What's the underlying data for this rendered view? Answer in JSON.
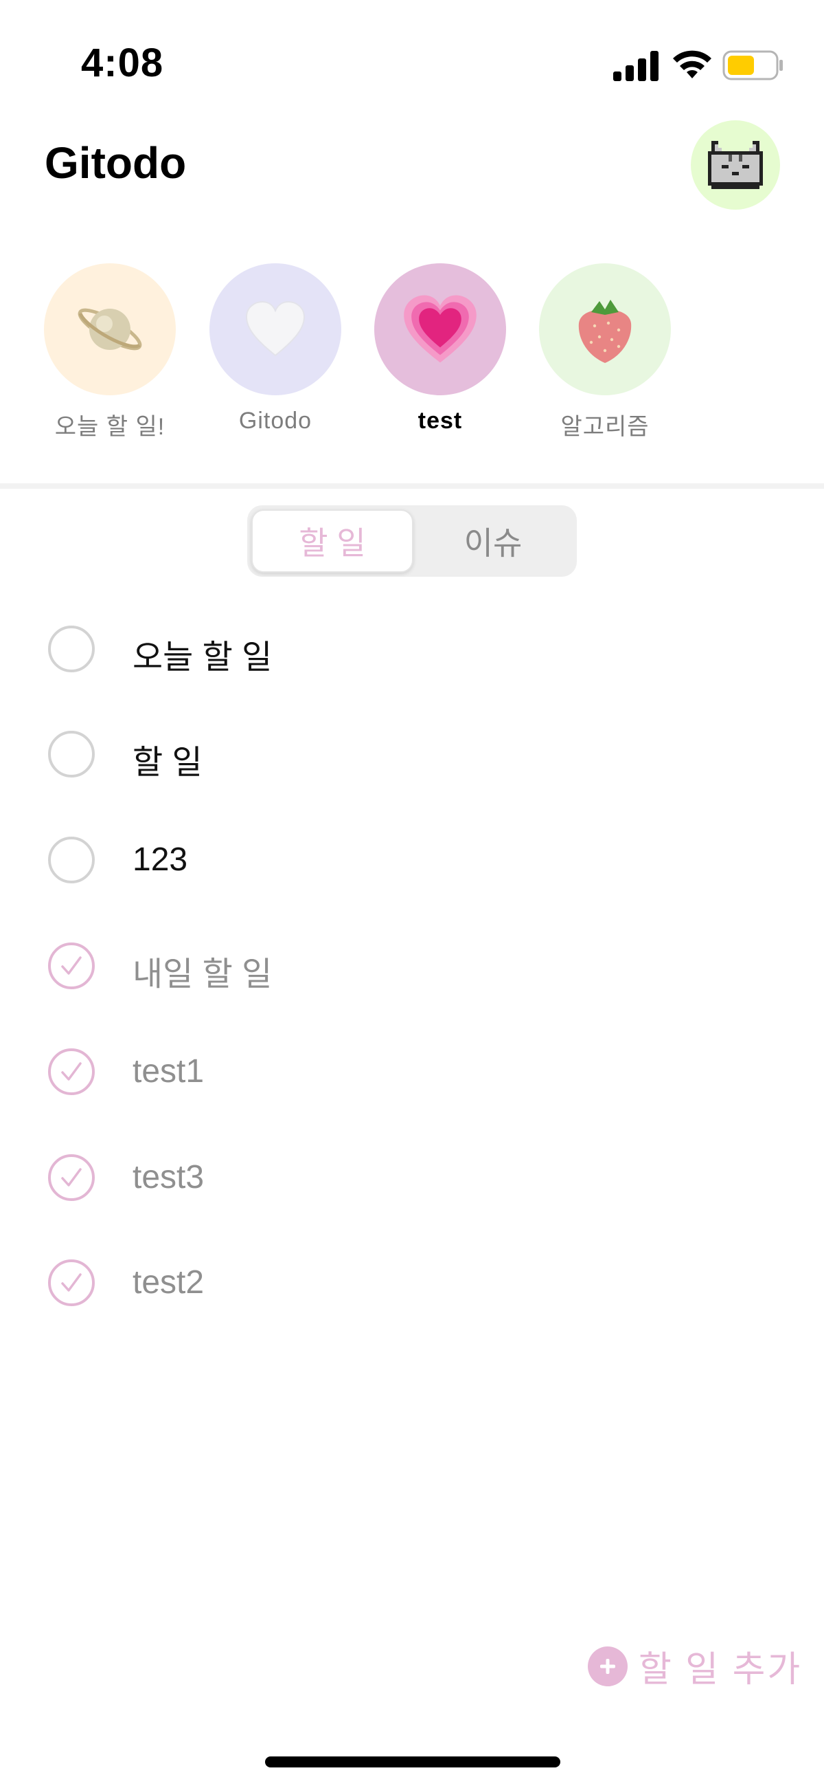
{
  "status_bar": {
    "time": "4:08",
    "icons": [
      "signal-icon",
      "wifi-icon",
      "battery-icon"
    ],
    "battery_color": "#FFCC00"
  },
  "header": {
    "title": "Gitodo",
    "avatar_icon": "pixel-cat-icon",
    "avatar_bg": "#E6FCD0"
  },
  "projects": [
    {
      "name": "오늘 할 일!",
      "icon": "ringed-planet-icon",
      "bg": "#FFF1DD",
      "active": false
    },
    {
      "name": "Gitodo",
      "icon": "white-heart-icon",
      "bg": "#E4E3F7",
      "active": false
    },
    {
      "name": "test",
      "icon": "growing-heart-icon",
      "bg": "#E5BEDC",
      "active": true
    },
    {
      "name": "알고리즘",
      "icon": "strawberry-icon",
      "bg": "#E8F7E0",
      "active": false
    }
  ],
  "tabs": {
    "todo": "할 일",
    "issue": "이슈",
    "selected": "할 일"
  },
  "tasks": [
    {
      "title": "오늘 할 일",
      "done": false
    },
    {
      "title": "할 일",
      "done": false
    },
    {
      "title": "123",
      "done": false
    },
    {
      "title": "내일 할 일",
      "done": true
    },
    {
      "title": "test1",
      "done": true
    },
    {
      "title": "test3",
      "done": true
    },
    {
      "title": "test2",
      "done": true
    }
  ],
  "add_button": {
    "label": "할 일 추가",
    "icon": "plus-circle-icon"
  },
  "colors": {
    "accent": "#E6B8D7",
    "done_text": "#8F8F8F",
    "unchecked_border": "#D3D3D3"
  }
}
